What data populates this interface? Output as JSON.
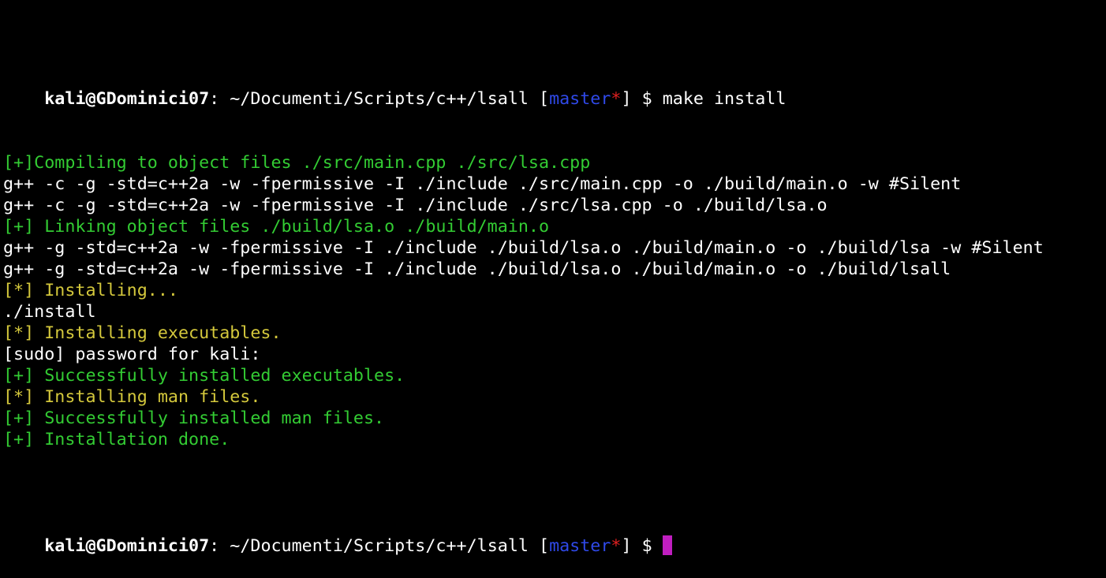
{
  "colors": {
    "background": "#000000",
    "text": "#ffffff",
    "green": "#33cc33",
    "yellow": "#d4c83c",
    "blue": "#2f49e8",
    "red": "#e02020",
    "cursor": "#c01ec0"
  },
  "prompt_start": {
    "user_host": "kali@GDominici07",
    "colon": ":",
    "path": " ~/Documenti/Scripts/c++/lsall ",
    "bracket_open": "[",
    "branch": "master",
    "dirty": "*",
    "bracket_close": "]",
    "symbol": " $ ",
    "command": "make install"
  },
  "output": [
    {
      "text": "[+]Compiling to object files ./src/main.cpp ./src/lsa.cpp",
      "color": "green"
    },
    {
      "text": "g++ -c -g -std=c++2a -w -fpermissive -I ./include ./src/main.cpp -o ./build/main.o -w #Silent",
      "color": "white"
    },
    {
      "text": "g++ -c -g -std=c++2a -w -fpermissive -I ./include ./src/lsa.cpp -o ./build/lsa.o",
      "color": "white"
    },
    {
      "text": "[+] Linking object files ./build/lsa.o ./build/main.o",
      "color": "green"
    },
    {
      "text": "g++ -g -std=c++2a -w -fpermissive -I ./include ./build/lsa.o ./build/main.o -o ./build/lsa -w #Silent",
      "color": "white"
    },
    {
      "text": "g++ -g -std=c++2a -w -fpermissive -I ./include ./build/lsa.o ./build/main.o -o ./build/lsall",
      "color": "white"
    },
    {
      "text": "[*] Installing...",
      "color": "yellow"
    },
    {
      "text": "./install",
      "color": "white"
    },
    {
      "text": "[*] Installing executables.",
      "color": "yellow"
    },
    {
      "text": "[sudo] password for kali:",
      "color": "white"
    },
    {
      "text": "[+] Successfully installed executables.",
      "color": "green"
    },
    {
      "text": "[*] Installing man files.",
      "color": "yellow"
    },
    {
      "text": "[+] Successfully installed man files.",
      "color": "green"
    },
    {
      "text": "[+] Installation done.",
      "color": "green"
    }
  ],
  "prompt_end": {
    "user_host": "kali@GDominici07",
    "colon": ":",
    "path": " ~/Documenti/Scripts/c++/lsall ",
    "bracket_open": "[",
    "branch": "master",
    "dirty": "*",
    "bracket_close": "]",
    "symbol": " $ "
  }
}
